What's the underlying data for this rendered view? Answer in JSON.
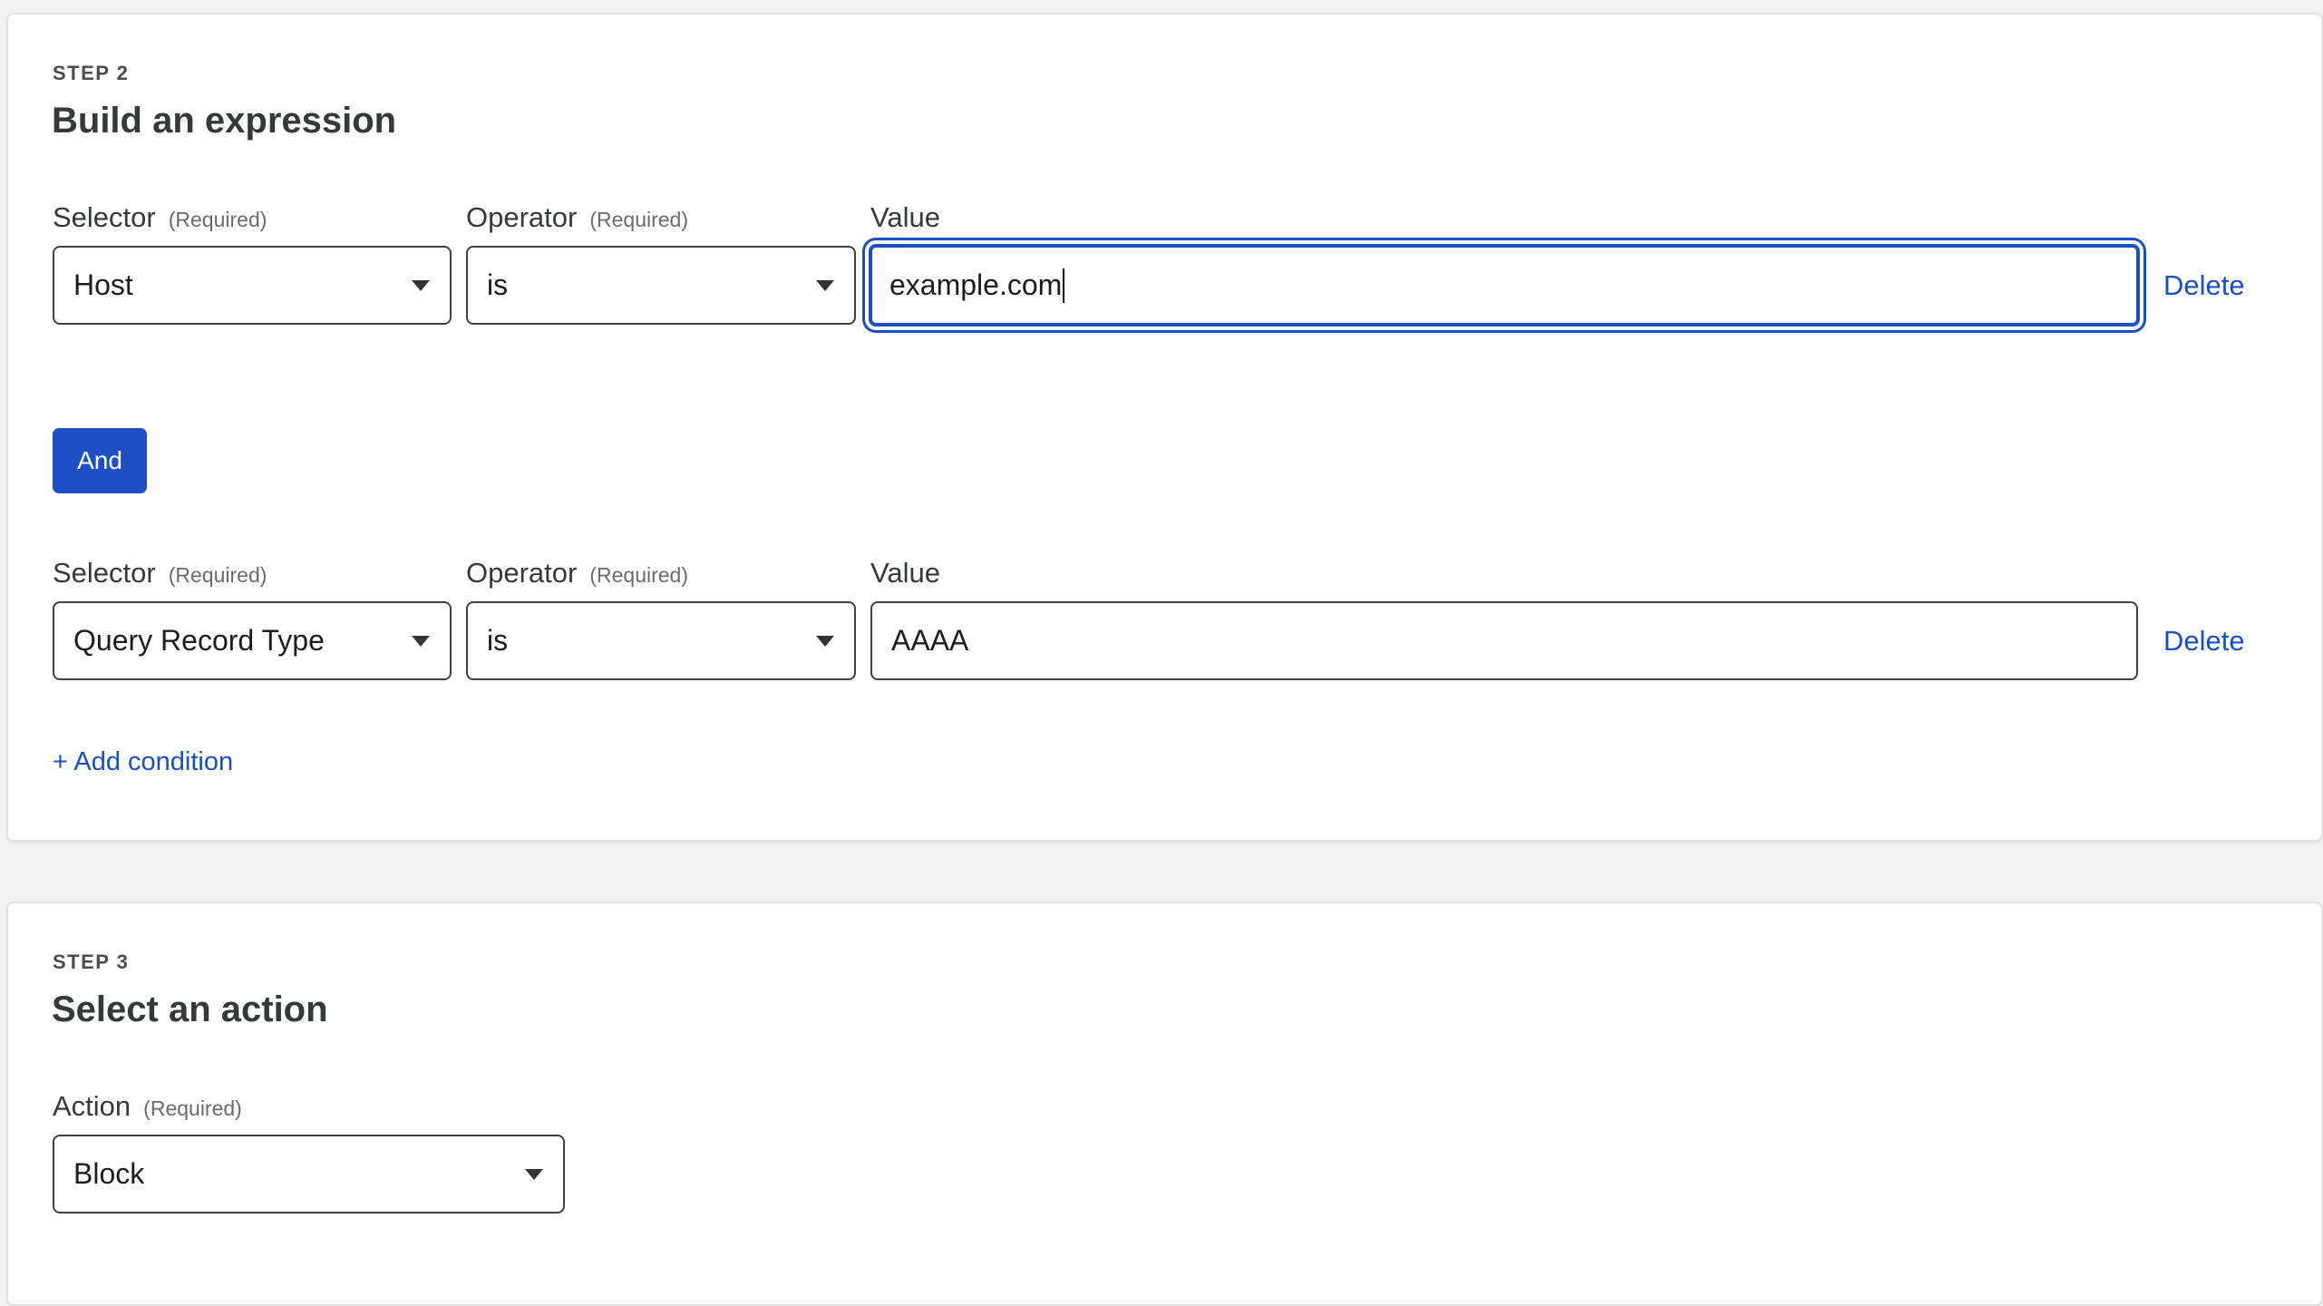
{
  "step2": {
    "step_label": "STEP 2",
    "title": "Build an expression",
    "conditions": [
      {
        "selector_label": "Selector",
        "selector_required": "(Required)",
        "selector_value": "Host",
        "operator_label": "Operator",
        "operator_required": "(Required)",
        "operator_value": "is",
        "value_label": "Value",
        "value": "example.com",
        "delete_label": "Delete"
      },
      {
        "selector_label": "Selector",
        "selector_required": "(Required)",
        "selector_value": "Query Record Type",
        "operator_label": "Operator",
        "operator_required": "(Required)",
        "operator_value": "is",
        "value_label": "Value",
        "value": "AAAA",
        "delete_label": "Delete"
      }
    ],
    "and_button_label": "And",
    "add_condition_label": "+ Add condition"
  },
  "step3": {
    "step_label": "STEP 3",
    "title": "Select an action",
    "action_label": "Action",
    "action_required": "(Required)",
    "action_value": "Block"
  },
  "colors": {
    "accent": "#1a4fc4",
    "background": "#f2f2f2",
    "card": "#ffffff"
  },
  "icons": {
    "select_caret": "caret-down-icon"
  }
}
